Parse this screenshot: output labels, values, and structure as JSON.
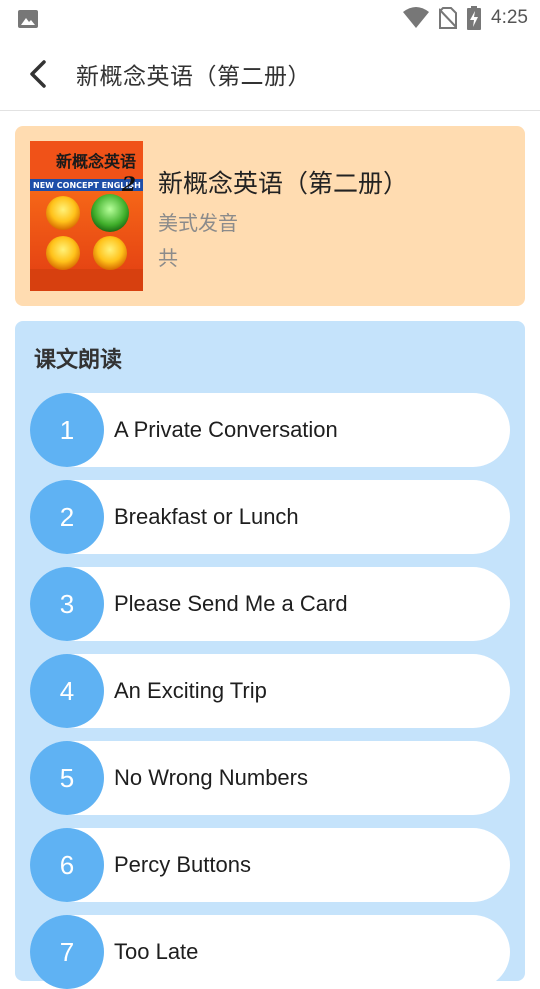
{
  "status_bar": {
    "time": "4:25"
  },
  "header": {
    "title": "新概念英语（第二册）"
  },
  "book": {
    "title": "新概念英语（第二册）",
    "subtitle": "美式发音",
    "count_text": "共",
    "cover": {
      "top_text": "新概念英语",
      "english_text": "NEW CONCEPT ENGLISH",
      "volume": "2"
    }
  },
  "lessons_section": {
    "title": "课文朗读",
    "items": [
      {
        "num": "1",
        "title": "A Private Conversation"
      },
      {
        "num": "2",
        "title": "Breakfast or Lunch"
      },
      {
        "num": "3",
        "title": "Please Send Me a Card"
      },
      {
        "num": "4",
        "title": "An Exciting Trip"
      },
      {
        "num": "5",
        "title": "No Wrong Numbers"
      },
      {
        "num": "6",
        "title": "Percy Buttons"
      },
      {
        "num": "7",
        "title": "Too Late"
      }
    ]
  }
}
